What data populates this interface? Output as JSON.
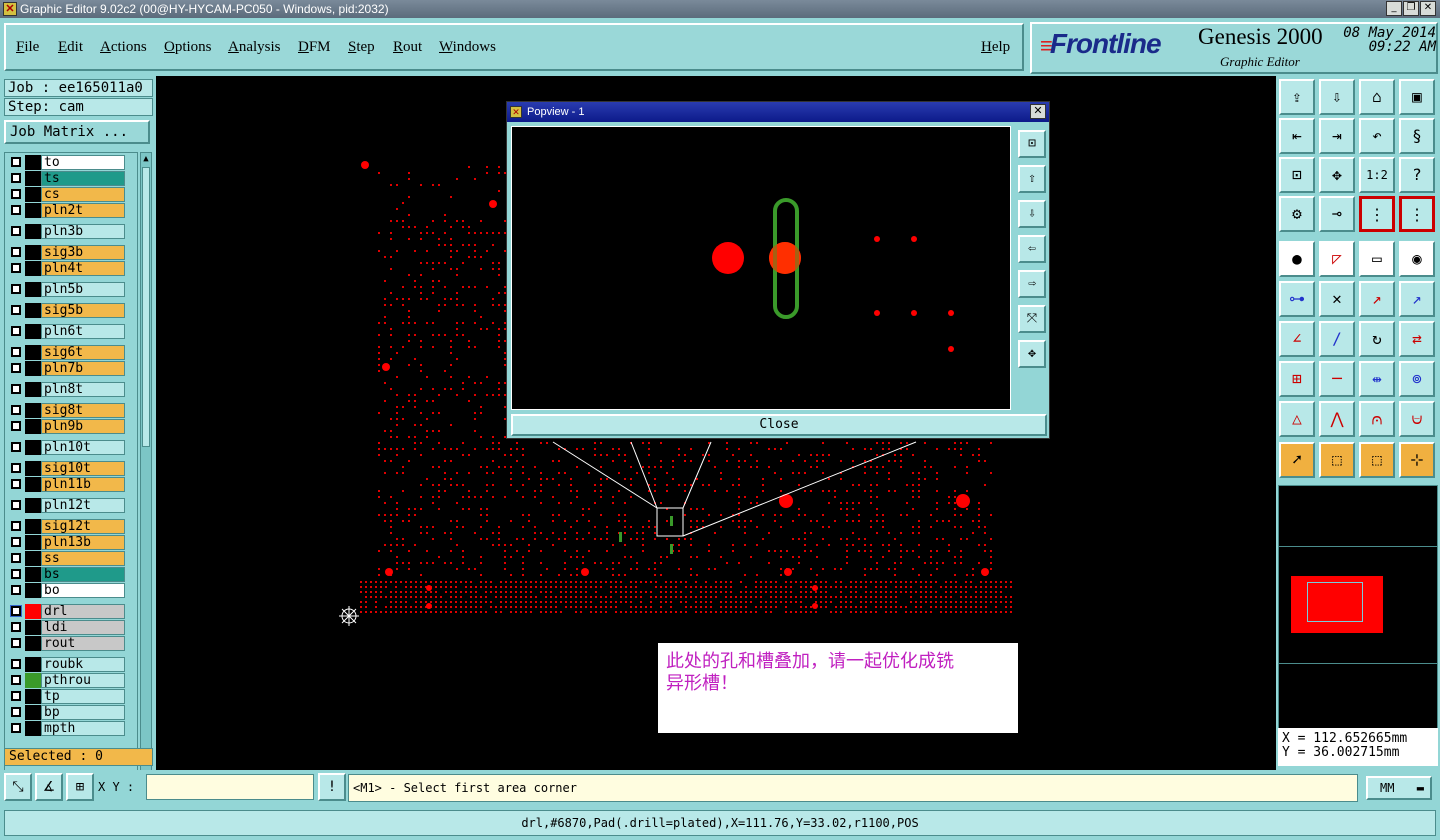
{
  "window": {
    "title": "Graphic Editor 9.02c2 (00@HY-HYCAM-PC050 - Windows, pid:2032)"
  },
  "menu": [
    "File",
    "Edit",
    "Actions",
    "Options",
    "Analysis",
    "DFM",
    "Step",
    "Rout",
    "Windows"
  ],
  "help": "Help",
  "brand": {
    "logo": "Frontline",
    "product": "Genesis 2000",
    "subtitle": "Graphic Editor",
    "date": "08 May 2014",
    "time": "09:22 AM"
  },
  "job": {
    "job_label": "Job : ee165011a0",
    "step_label": "Step: cam",
    "matrix_button": "Job Matrix ..."
  },
  "layers": [
    {
      "name": "to",
      "color": "#ffffff",
      "swatch": "#000000"
    },
    {
      "name": "ts",
      "color": "#1f9a8a",
      "swatch": "#000000"
    },
    {
      "name": "cs",
      "color": "#f2b84a",
      "swatch": "#000000"
    },
    {
      "name": "pln2t",
      "color": "#f2b84a",
      "swatch": "#000000"
    },
    {
      "name": "pln3b",
      "color": "#b8e8e8",
      "swatch": "#000000"
    },
    {
      "name": "sig3b",
      "color": "#f2b84a",
      "swatch": "#000000"
    },
    {
      "name": "pln4t",
      "color": "#f2b84a",
      "swatch": "#000000"
    },
    {
      "name": "pln5b",
      "color": "#b8e8e8",
      "swatch": "#000000"
    },
    {
      "name": "sig5b",
      "color": "#f2b84a",
      "swatch": "#000000"
    },
    {
      "name": "pln6t",
      "color": "#b8e8e8",
      "swatch": "#000000"
    },
    {
      "name": "sig6t",
      "color": "#f2b84a",
      "swatch": "#000000"
    },
    {
      "name": "pln7b",
      "color": "#f2b84a",
      "swatch": "#000000"
    },
    {
      "name": "pln8t",
      "color": "#b8e8e8",
      "swatch": "#000000"
    },
    {
      "name": "sig8t",
      "color": "#f2b84a",
      "swatch": "#000000"
    },
    {
      "name": "pln9b",
      "color": "#f2b84a",
      "swatch": "#000000"
    },
    {
      "name": "pln10t",
      "color": "#b8e8e8",
      "swatch": "#000000"
    },
    {
      "name": "sig10t",
      "color": "#f2b84a",
      "swatch": "#000000"
    },
    {
      "name": "pln11b",
      "color": "#f2b84a",
      "swatch": "#000000"
    },
    {
      "name": "pln12t",
      "color": "#b8e8e8",
      "swatch": "#000000"
    },
    {
      "name": "sig12t",
      "color": "#f2b84a",
      "swatch": "#000000"
    },
    {
      "name": "pln13b",
      "color": "#f2b84a",
      "swatch": "#000000"
    },
    {
      "name": "ss",
      "color": "#f2b84a",
      "swatch": "#000000"
    },
    {
      "name": "bs",
      "color": "#1f9a8a",
      "swatch": "#000000"
    },
    {
      "name": "bo",
      "color": "#ffffff",
      "swatch": "#000000"
    },
    {
      "name": "drl",
      "color": "#c8c8c8",
      "swatch": "#ff0000"
    },
    {
      "name": "ldi",
      "color": "#c8c8c8",
      "swatch": "#000000"
    },
    {
      "name": "rout",
      "color": "#c8c8c8",
      "swatch": "#000000"
    },
    {
      "name": "roubk",
      "color": "#b8e8e8",
      "swatch": "#000000"
    },
    {
      "name": "pthrou",
      "color": "#b8e8e8",
      "swatch": "#3a9a2a"
    },
    {
      "name": "tp",
      "color": "#b8e8e8",
      "swatch": "#000000"
    },
    {
      "name": "bp",
      "color": "#b8e8e8",
      "swatch": "#000000"
    },
    {
      "name": "mpth",
      "color": "#b8e8e8",
      "swatch": "#000000"
    }
  ],
  "selected": "Selected : 0",
  "popview": {
    "title": "Popview - 1",
    "close": "Close"
  },
  "note": {
    "line1": "此处的孔和槽叠加，请一起优化成铣",
    "line2": "异形槽！"
  },
  "coords": {
    "x": "X = 112.652665mm",
    "y": "Y = 36.002715mm"
  },
  "bottom": {
    "xy_label": "X Y :",
    "xy_value": "",
    "prompt": "<M1> - Select first area corner",
    "units": "MM"
  },
  "status": "drl,#6870,Pad(.drill=plated),X=111.76,Y=33.02,r1100,POS",
  "colors": {
    "accent": "#93d6d6",
    "drill_red": "#ff0000",
    "slot_green": "#3a9a2a"
  }
}
